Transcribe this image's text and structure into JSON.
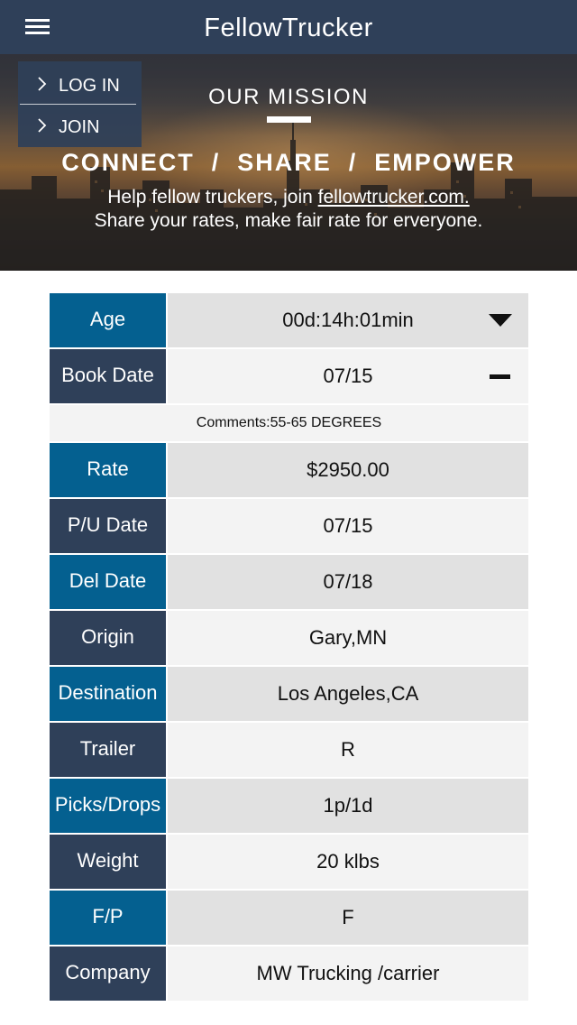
{
  "header": {
    "title": "FellowTrucker"
  },
  "menu": {
    "items": [
      {
        "label": "LOG IN"
      },
      {
        "label": "JOIN"
      }
    ]
  },
  "hero": {
    "mission_title": "OUR MISSION",
    "slogan": "CONNECT  /  SHARE  /  EMPOWER",
    "tagline_prefix": "Help fellow truckers, join ",
    "tagline_link": "fellowtrucker.com.",
    "tagline_line2": "Share your rates, make fair rate for erveryone."
  },
  "load": {
    "age": {
      "label": "Age",
      "value": "00d:14h:01min"
    },
    "book_date": {
      "label": "Book Date",
      "value": "07/15"
    },
    "comments": "Comments:55-65 DEGREES",
    "rows": [
      {
        "label": "Rate",
        "value": "$2950.00"
      },
      {
        "label": "P/U Date",
        "value": "07/15"
      },
      {
        "label": "Del Date",
        "value": "07/18"
      },
      {
        "label": "Origin",
        "value": "Gary,MN"
      },
      {
        "label": "Destination",
        "value": "Los Angeles,CA"
      },
      {
        "label": "Trailer",
        "value": "R"
      },
      {
        "label": "Picks/Drops",
        "value": "1p/1d"
      },
      {
        "label": "Weight",
        "value": "20 klbs"
      },
      {
        "label": "F/P",
        "value": "F"
      },
      {
        "label": "Company",
        "value": "MW Trucking /carrier"
      }
    ]
  },
  "colors": {
    "header_bg": "#2f4059",
    "label_blue": "#046090",
    "label_navy": "#2f4059",
    "value_dark": "#e1e1e1",
    "value_light": "#f3f3f3"
  },
  "icons": {
    "menu": "hamburger-menu-icon",
    "menu_item": "chevron-right-icon",
    "expand": "caret-down-icon",
    "collapse": "minus-icon"
  }
}
